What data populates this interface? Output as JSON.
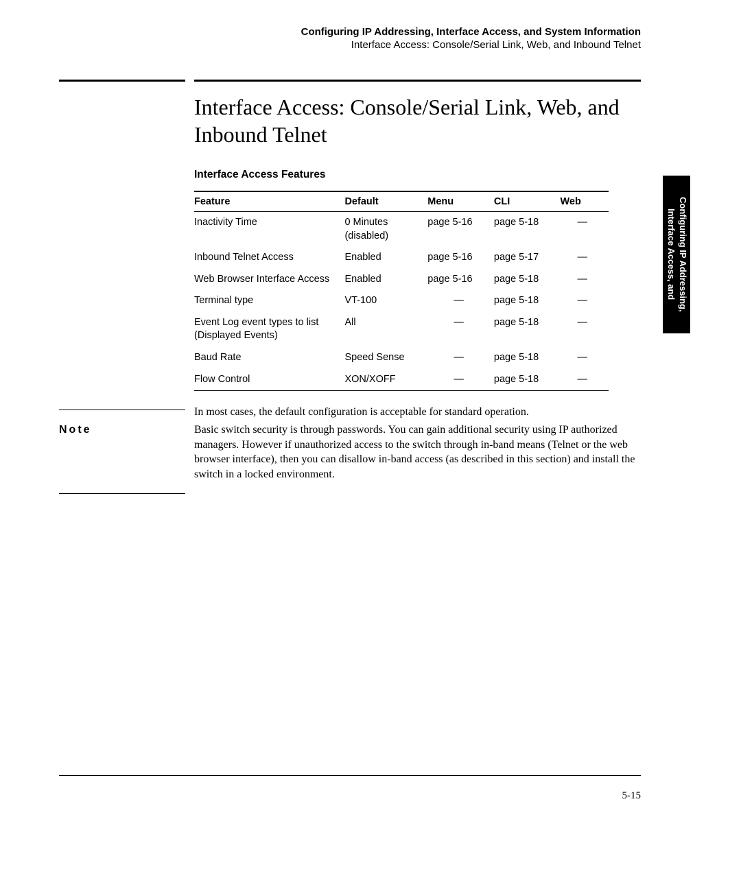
{
  "header": {
    "bold": "Configuring IP Addressing, Interface Access, and System Information",
    "sub": "Interface Access: Console/Serial Link, Web, and Inbound Telnet"
  },
  "main_heading": "Interface Access: Console/Serial Link, Web, and Inbound Telnet",
  "table_caption": "Interface Access Features",
  "table": {
    "headers": {
      "feature": "Feature",
      "default": "Default",
      "menu": "Menu",
      "cli": "CLI",
      "web": "Web"
    },
    "rows": [
      {
        "feature": "Inactivity Time",
        "default": "0 Minutes (disabled)",
        "menu": "page 5-16",
        "cli": "page 5-18",
        "web": "—"
      },
      {
        "feature": "Inbound Telnet Access",
        "default": "Enabled",
        "menu": "page 5-16",
        "cli": "page 5-17",
        "web": "—"
      },
      {
        "feature": "Web Browser Interface Access",
        "default": "Enabled",
        "menu": "page 5-16",
        "cli": "page 5-18",
        "web": "—"
      },
      {
        "feature": "Terminal type",
        "default": "VT-100",
        "menu": "—",
        "cli": "page 5-18",
        "web": "—"
      },
      {
        "feature": "Event  Log event types to list (Displayed Events)",
        "default": "All",
        "menu": "—",
        "cli": "page 5-18",
        "web": "—"
      },
      {
        "feature": "Baud Rate",
        "default": "Speed Sense",
        "menu": "—",
        "cli": "page 5-18",
        "web": "—"
      },
      {
        "feature": "Flow Control",
        "default": "XON/XOFF",
        "menu": "—",
        "cli": "page 5-18",
        "web": "—"
      }
    ]
  },
  "body_para": "In most cases, the default configuration is acceptable for standard operation.",
  "note": {
    "label": "Note",
    "text": "Basic switch security is through passwords. You can gain additional security using IP authorized managers. However if unauthorized access to the switch through in-band means (Telnet or the web browser interface), then you can disallow in-band access (as described in this section) and install the switch in a locked environment."
  },
  "side_tab": "Configuring IP Addressing,\nInterface Access, and",
  "page_num": "5-15"
}
